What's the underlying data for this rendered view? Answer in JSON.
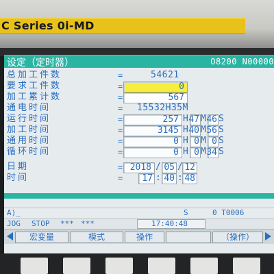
{
  "brand": {
    "text": "C Series 0i-MD"
  },
  "header": {
    "title": "设定（定时器）",
    "program": "O8200 N00000"
  },
  "rows": [
    {
      "label": "总加工件数",
      "value": "54621"
    },
    {
      "label": "要求工件数",
      "value": "0"
    },
    {
      "label": "加工累计数",
      "value": "567"
    },
    {
      "label": "通电时间",
      "value": "15532H35M"
    },
    {
      "label": "运行时间",
      "h": "257",
      "m": "47",
      "s": "46"
    },
    {
      "label": "加工时间",
      "h": "3145",
      "m": "40",
      "s": "56"
    },
    {
      "label": "通用时间",
      "h": "0",
      "m": "0",
      "s": "0"
    },
    {
      "label": "循环时间",
      "h": "0",
      "m": "0",
      "s": "34"
    },
    {
      "label": "日期",
      "year": "2018",
      "month": "05",
      "day": "12"
    },
    {
      "label": "时间",
      "hour": "17",
      "minute": "40",
      "second": "48"
    }
  ],
  "units": {
    "h": "H",
    "m": "M",
    "s": "S",
    "eq": "="
  },
  "input_line": {
    "prompt": "A)_",
    "mode": "S",
    "tool": "0 T0006"
  },
  "status_line": {
    "mode": "JOG",
    "state": "STOP",
    "stars1": "***",
    "stars2": "***",
    "clock": "17:40:48"
  },
  "softkeys": [
    {
      "label": "宏变量"
    },
    {
      "label": "模式"
    },
    {
      "label": "操作"
    },
    {
      "label": ""
    },
    {
      "label": "（操作）"
    }
  ]
}
